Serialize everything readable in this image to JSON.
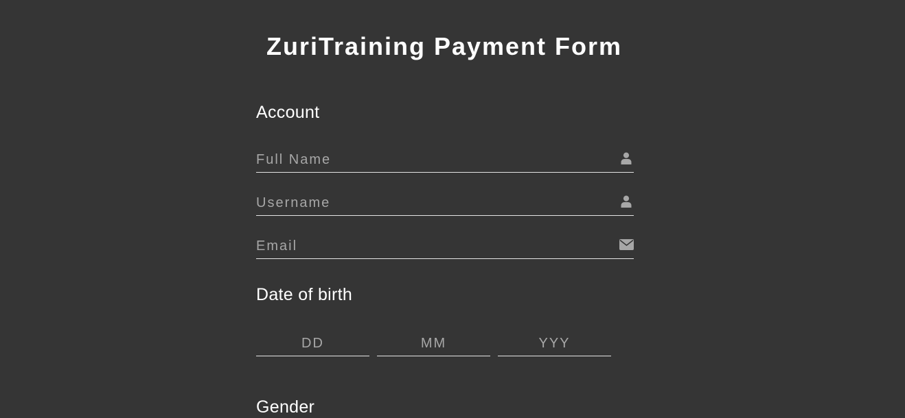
{
  "header": {
    "title": "ZuriTraining Payment Form"
  },
  "account": {
    "heading": "Account",
    "full_name_placeholder": "Full Name",
    "username_placeholder": "Username",
    "email_placeholder": "Email"
  },
  "dob": {
    "heading": "Date of birth",
    "day_placeholder": "DD",
    "month_placeholder": "MM",
    "year_placeholder": "YYY"
  },
  "gender": {
    "heading": "Gender"
  },
  "icons": {
    "full_name": "user-icon",
    "username": "user-icon",
    "email": "envelope-icon"
  },
  "colors": {
    "background": "#353535",
    "text": "#ffffff",
    "placeholder": "#a7a7a7",
    "icon": "#a7a7a7",
    "underline": "#e6e6e6"
  }
}
